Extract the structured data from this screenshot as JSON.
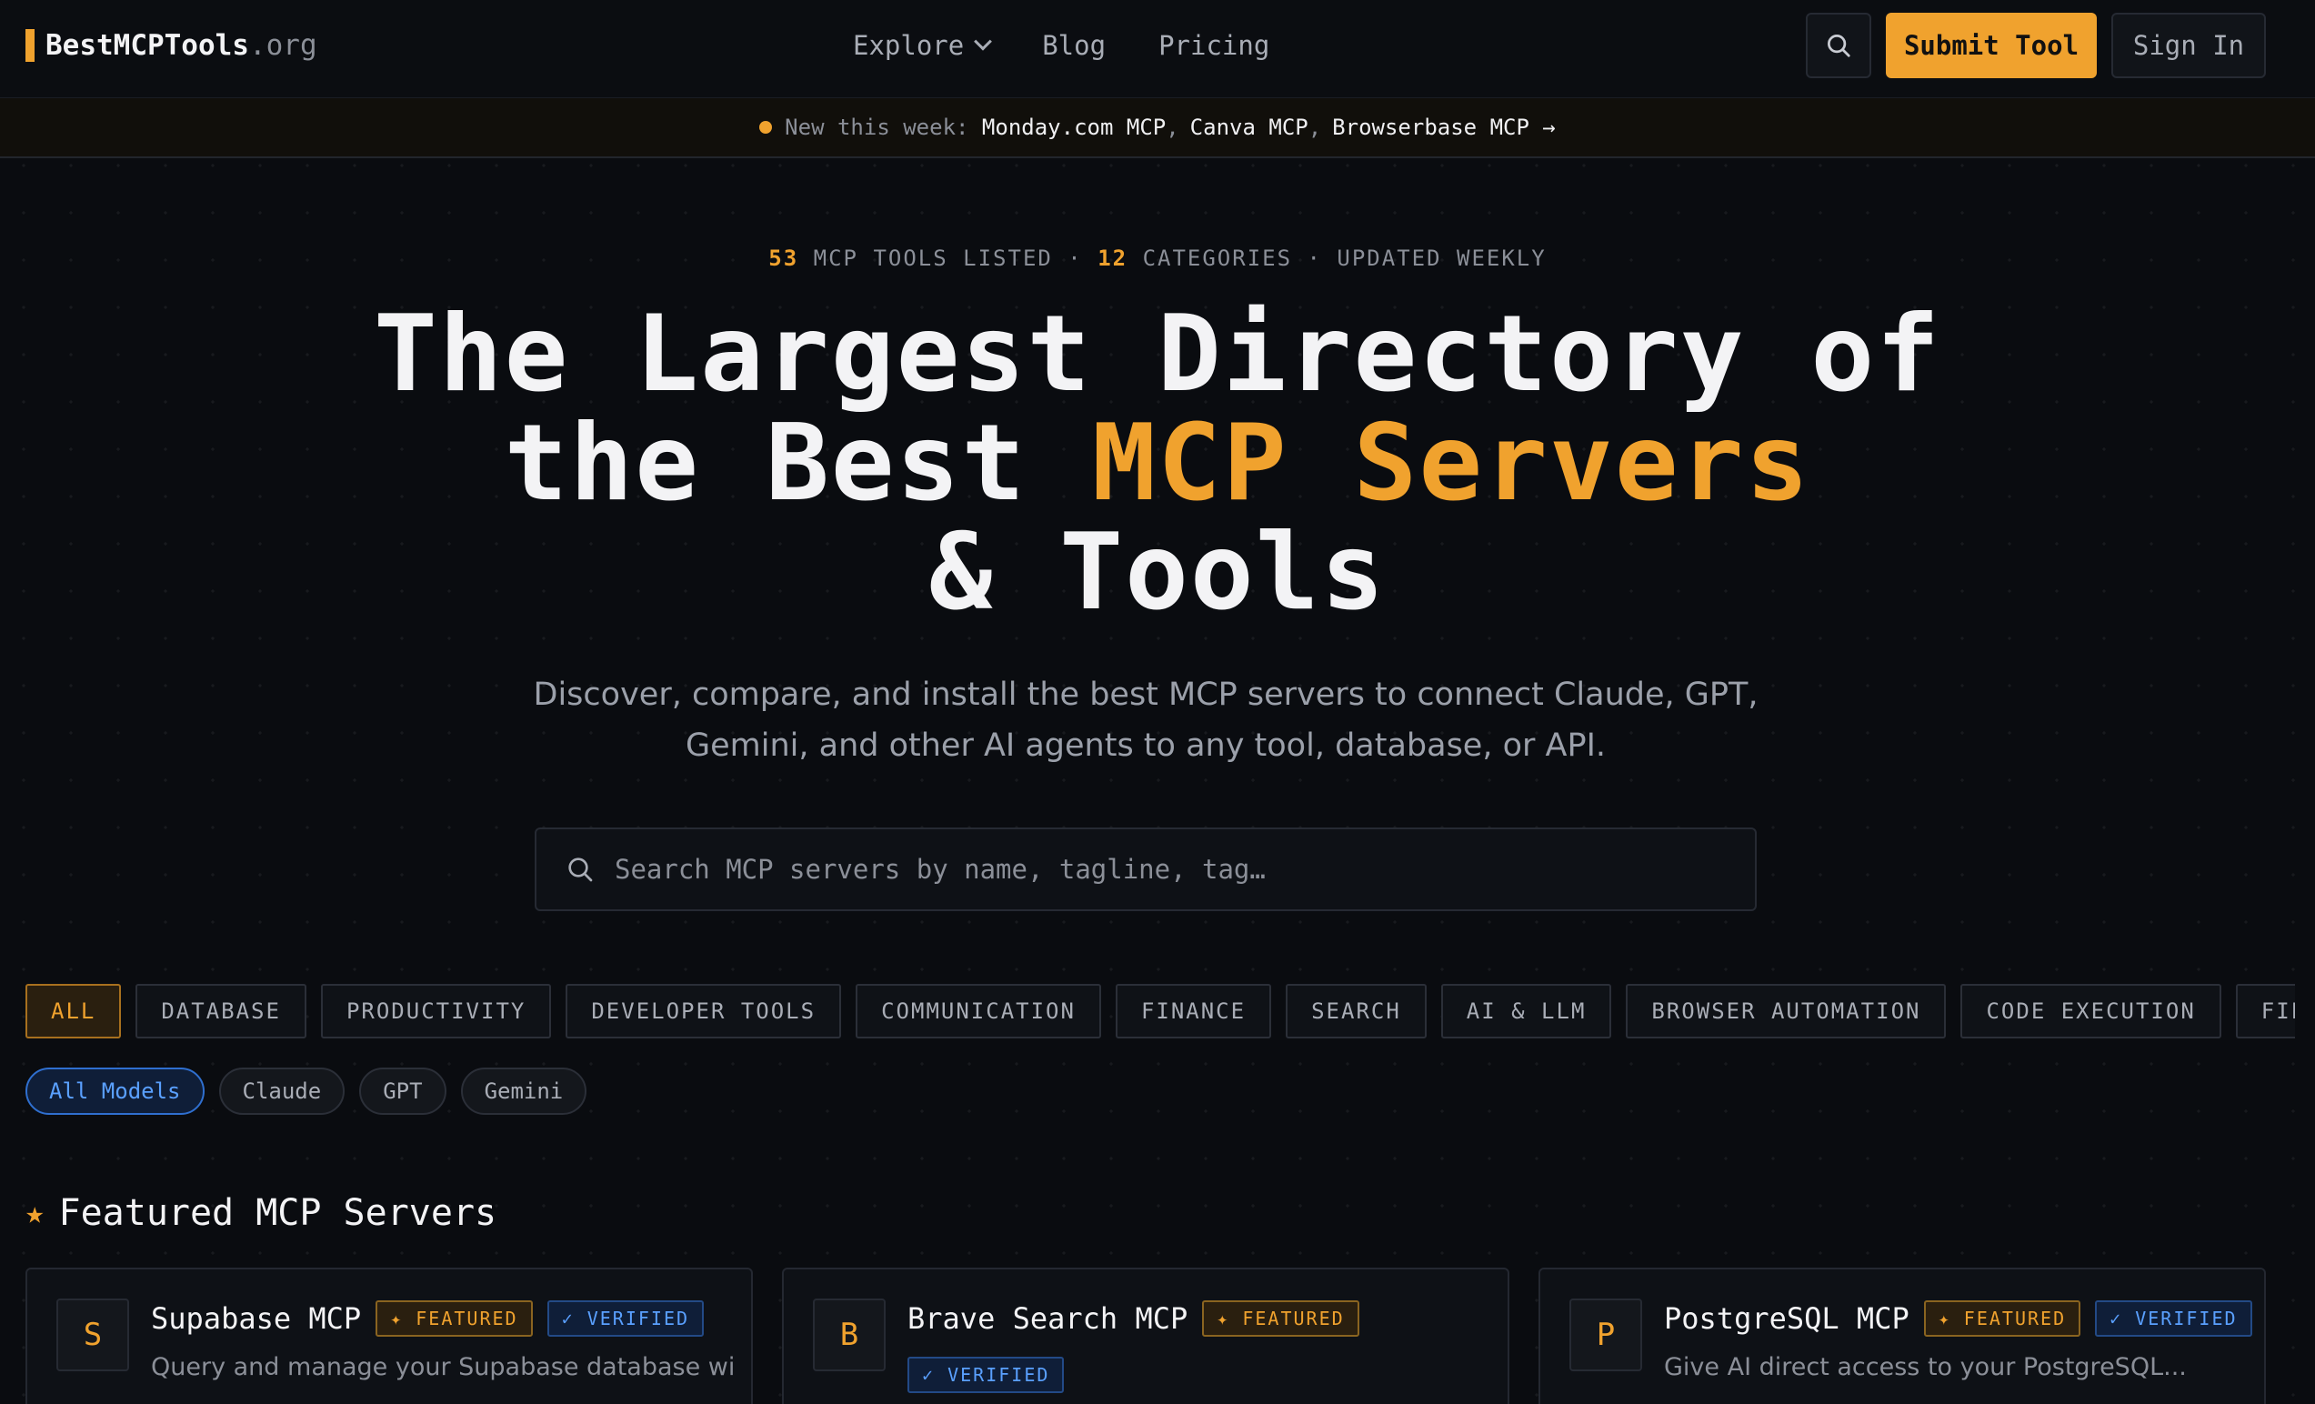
{
  "nav": {
    "logo_main": "BestMCPTools",
    "logo_tld": ".org",
    "links": [
      "Explore",
      "Blog",
      "Pricing"
    ],
    "submit_label": "Submit Tool",
    "signin_label": "Sign In",
    "search_icon": "search-icon"
  },
  "announcement": {
    "prefix": "New this week:",
    "items": [
      "Monday.com MCP",
      "Canva MCP",
      "Browserbase MCP →"
    ]
  },
  "stats": {
    "tools_count": "53",
    "tools_label": "MCP TOOLS LISTED ·",
    "categories_count": "12",
    "categories_label": "CATEGORIES · UPDATED WEEKLY"
  },
  "hero": {
    "line1": "The Largest Directory of",
    "line2_pre": "the Best ",
    "line2_accent": "MCP Servers",
    "line3": "& Tools",
    "subtitle": "Discover, compare, and install the best MCP servers to connect Claude, GPT, Gemini, and other AI agents to any tool, database, or API."
  },
  "search": {
    "placeholder": "Search MCP servers by name, tagline, tag…"
  },
  "categories": [
    "ALL",
    "DATABASE",
    "PRODUCTIVITY",
    "DEVELOPER TOOLS",
    "COMMUNICATION",
    "FINANCE",
    "SEARCH",
    "AI & LLM",
    "BROWSER AUTOMATION",
    "CODE EXECUTION",
    "FILE SYSTEM"
  ],
  "models": [
    "All Models",
    "Claude",
    "GPT",
    "Gemini"
  ],
  "featured": {
    "heading": "Featured MCP Servers",
    "cards": [
      {
        "initial": "S",
        "name": "Supabase MCP",
        "featured": "✦ FEATURED",
        "verified": "✓ VERIFIED",
        "desc": "Query and manage your Supabase database wit..."
      },
      {
        "initial": "B",
        "name": "Brave Search MCP",
        "featured": "✦ FEATURED",
        "verified": "✓ VERIFIED",
        "desc": ""
      },
      {
        "initial": "P",
        "name": "PostgreSQL MCP",
        "featured": "✦ FEATURED",
        "verified": "✓ VERIFIED",
        "desc": "Give AI direct access to your PostgreSQL..."
      }
    ]
  },
  "colors": {
    "accent": "#f0a22e",
    "verified_blue": "#5aa0ff",
    "background": "#0a0c10"
  }
}
